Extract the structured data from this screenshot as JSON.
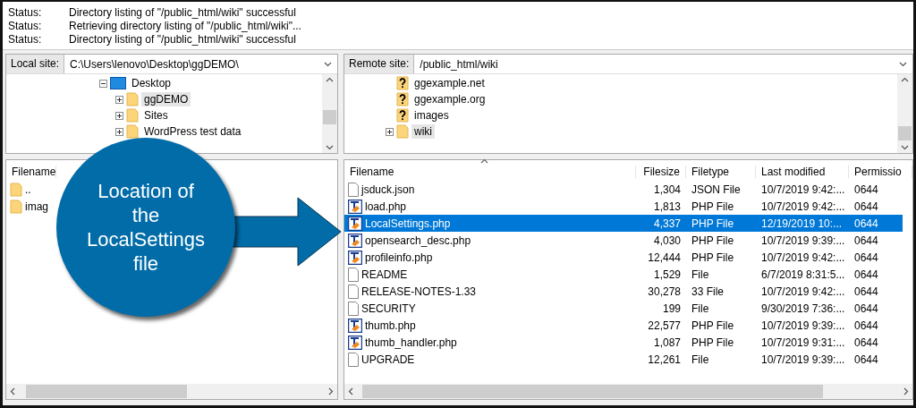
{
  "status_log": [
    {
      "label": "Status:",
      "message": "Directory listing of \"/public_html/wiki\" successful"
    },
    {
      "label": "Status:",
      "message": "Retrieving directory listing of \"/public_html/wiki\"..."
    },
    {
      "label": "Status:",
      "message": "Directory listing of \"/public_html/wiki\" successful"
    }
  ],
  "local": {
    "site_label": "Local site:",
    "path": "C:\\Users\\lenovo\\Desktop\\ggDEMO\\",
    "tree": [
      {
        "name": "Desktop",
        "kind": "desktop",
        "expanded": true,
        "selected": false,
        "children": [
          {
            "name": "ggDEMO",
            "kind": "folder",
            "expanded": false,
            "selected": true
          },
          {
            "name": "Sites",
            "kind": "folder",
            "expanded": false,
            "selected": false
          },
          {
            "name": "WordPress test data",
            "kind": "folder",
            "expanded": false,
            "selected": false
          }
        ]
      }
    ],
    "files_header": "Filename",
    "files": [
      {
        "name": ".."
      },
      {
        "name": "imag"
      }
    ]
  },
  "remote": {
    "site_label": "Remote site:",
    "path": "/public_html/wiki",
    "tree": [
      {
        "name": "ggexample.net",
        "kind": "unknown",
        "selected": false
      },
      {
        "name": "ggexample.org",
        "kind": "unknown",
        "selected": false
      },
      {
        "name": "images",
        "kind": "unknown",
        "selected": false
      },
      {
        "name": "wiki",
        "kind": "folder",
        "expanded": false,
        "selected": true
      }
    ],
    "columns": [
      "Filename",
      "Filesize",
      "Filetype",
      "Last modified",
      "Permissio"
    ],
    "files": [
      {
        "kind": "file",
        "name": "jsduck.json",
        "size": "1,304",
        "type": "JSON File",
        "modified": "10/7/2019 9:42:...",
        "perm": "0644",
        "selected": false
      },
      {
        "kind": "php",
        "name": "load.php",
        "size": "1,813",
        "type": "PHP File",
        "modified": "10/7/2019 9:42:...",
        "perm": "0644",
        "selected": false
      },
      {
        "kind": "php",
        "name": "LocalSettings.php",
        "size": "4,337",
        "type": "PHP File",
        "modified": "12/19/2019 10:...",
        "perm": "0644",
        "selected": true
      },
      {
        "kind": "php",
        "name": "opensearch_desc.php",
        "size": "4,030",
        "type": "PHP File",
        "modified": "10/7/2019 9:39:...",
        "perm": "0644",
        "selected": false
      },
      {
        "kind": "php",
        "name": "profileinfo.php",
        "size": "12,444",
        "type": "PHP File",
        "modified": "10/7/2019 9:42:...",
        "perm": "0644",
        "selected": false
      },
      {
        "kind": "file",
        "name": "README",
        "size": "1,529",
        "type": "File",
        "modified": "6/7/2019 8:31:5...",
        "perm": "0644",
        "selected": false
      },
      {
        "kind": "file",
        "name": "RELEASE-NOTES-1.33",
        "size": "30,278",
        "type": "33 File",
        "modified": "10/7/2019 9:42:...",
        "perm": "0644",
        "selected": false
      },
      {
        "kind": "file",
        "name": "SECURITY",
        "size": "199",
        "type": "File",
        "modified": "9/30/2019 7:36:...",
        "perm": "0644",
        "selected": false
      },
      {
        "kind": "php",
        "name": "thumb.php",
        "size": "22,577",
        "type": "PHP File",
        "modified": "10/7/2019 9:39:...",
        "perm": "0644",
        "selected": false
      },
      {
        "kind": "php",
        "name": "thumb_handler.php",
        "size": "1,087",
        "type": "PHP File",
        "modified": "10/7/2019 9:31:...",
        "perm": "0644",
        "selected": false
      },
      {
        "kind": "file",
        "name": "UPGRADE",
        "size": "12,261",
        "type": "File",
        "modified": "10/7/2019 9:39:...",
        "perm": "0644",
        "selected": false
      }
    ]
  },
  "callout": {
    "text": "Location of the LocalSettings file"
  }
}
